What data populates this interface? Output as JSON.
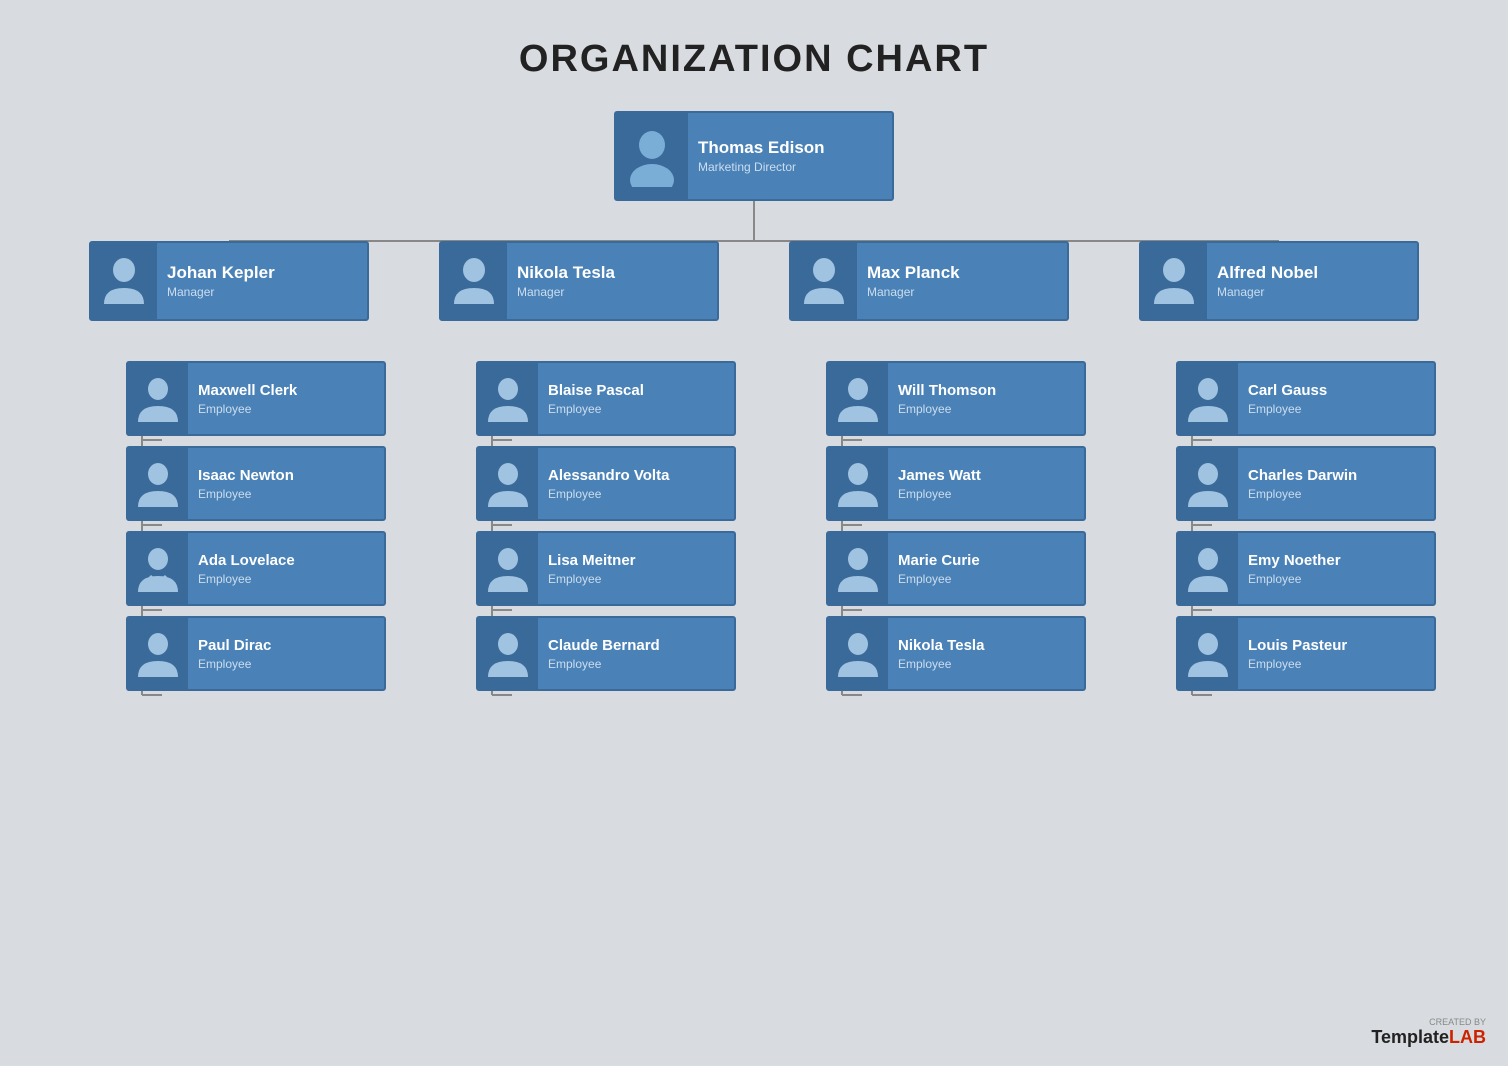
{
  "title": "ORGANIZATION CHART",
  "top": {
    "name": "Thomas Edison",
    "role": "Marketing Director",
    "avatar": "male"
  },
  "managers": [
    {
      "name": "Johan Kepler",
      "role": "Manager",
      "avatar": "female"
    },
    {
      "name": "Nikola Tesla",
      "role": "Manager",
      "avatar": "male"
    },
    {
      "name": "Max Planck",
      "role": "Manager",
      "avatar": "male"
    },
    {
      "name": "Alfred Nobel",
      "role": "Manager",
      "avatar": "male"
    }
  ],
  "employees": [
    [
      {
        "name": "Maxwell Clerk",
        "role": "Employee",
        "avatar": "male"
      },
      {
        "name": "Isaac Newton",
        "role": "Employee",
        "avatar": "male"
      },
      {
        "name": "Ada Lovelace",
        "role": "Employee",
        "avatar": "female"
      },
      {
        "name": "Paul Dirac",
        "role": "Employee",
        "avatar": "male"
      }
    ],
    [
      {
        "name": "Blaise Pascal",
        "role": "Employee",
        "avatar": "male"
      },
      {
        "name": "Alessandro Volta",
        "role": "Employee",
        "avatar": "male"
      },
      {
        "name": "Lisa Meitner",
        "role": "Employee",
        "avatar": "female"
      },
      {
        "name": "Claude Bernard",
        "role": "Employee",
        "avatar": "male"
      }
    ],
    [
      {
        "name": "Will Thomson",
        "role": "Employee",
        "avatar": "male"
      },
      {
        "name": "James Watt",
        "role": "Employee",
        "avatar": "male"
      },
      {
        "name": "Marie Curie",
        "role": "Employee",
        "avatar": "female"
      },
      {
        "name": "Nikola Tesla",
        "role": "Employee",
        "avatar": "male"
      }
    ],
    [
      {
        "name": "Carl Gauss",
        "role": "Employee",
        "avatar": "male"
      },
      {
        "name": "Charles Darwin",
        "role": "Employee",
        "avatar": "male"
      },
      {
        "name": "Emy Noether",
        "role": "Employee",
        "avatar": "female"
      },
      {
        "name": "Louis Pasteur",
        "role": "Employee",
        "avatar": "male"
      }
    ]
  ],
  "watermark": {
    "created_by": "CREATED BY",
    "brand1": "Template",
    "brand2": "LAB"
  }
}
